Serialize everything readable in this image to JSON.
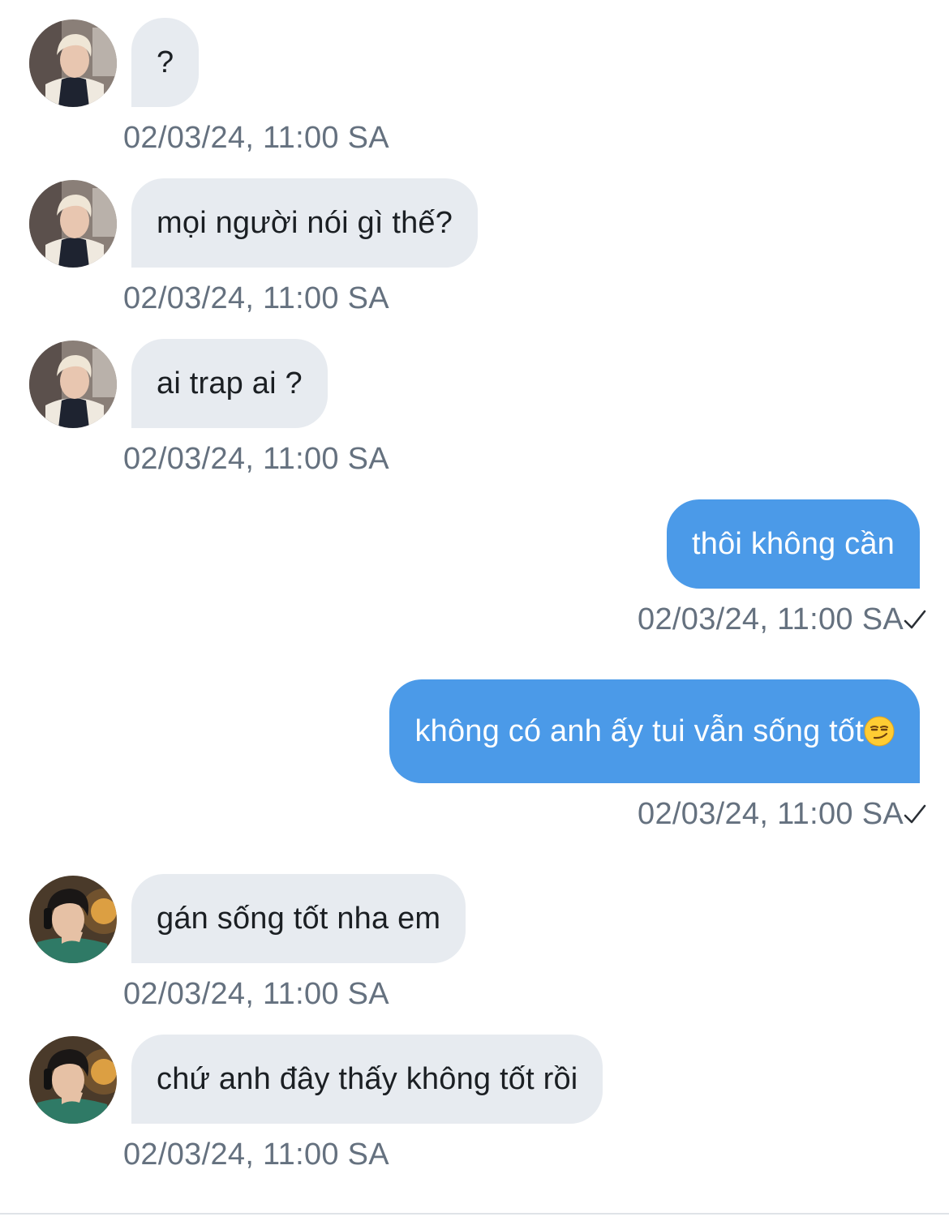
{
  "conversation": {
    "messages": [
      {
        "direction": "incoming",
        "sender_avatar": "blond-user-avatar",
        "text": "?",
        "timestamp": "02/03/24, 11:00 SA"
      },
      {
        "direction": "incoming",
        "sender_avatar": "blond-user-avatar",
        "text": "mọi người nói gì thế?",
        "timestamp": "02/03/24, 11:00 SA"
      },
      {
        "direction": "incoming",
        "sender_avatar": "blond-user-avatar",
        "text": "ai trap ai ?",
        "timestamp": "02/03/24, 11:00 SA"
      },
      {
        "direction": "outgoing",
        "text": "thôi không cần",
        "timestamp": "02/03/24, 11:00 SA",
        "status": "sent",
        "status_icon": "checkmark-icon"
      },
      {
        "direction": "outgoing",
        "text": "không có anh ấy tui vẫn sống tốt",
        "emoji": "smirking-face-emoji",
        "timestamp": "02/03/24, 11:00 SA",
        "status": "sent",
        "status_icon": "checkmark-icon"
      },
      {
        "direction": "incoming",
        "sender_avatar": "dark-hair-user-avatar",
        "text": "gán sống tốt nha em",
        "timestamp": "02/03/24, 11:00 SA"
      },
      {
        "direction": "incoming",
        "sender_avatar": "dark-hair-user-avatar",
        "text": "chứ anh đây thấy không tốt rồi",
        "timestamp": "02/03/24, 11:00 SA"
      }
    ]
  },
  "colors": {
    "incoming_bubble": "#e7ebf0",
    "outgoing_bubble": "#4b9ae8",
    "timestamp_text": "#65717f",
    "background": "#ffffff"
  }
}
